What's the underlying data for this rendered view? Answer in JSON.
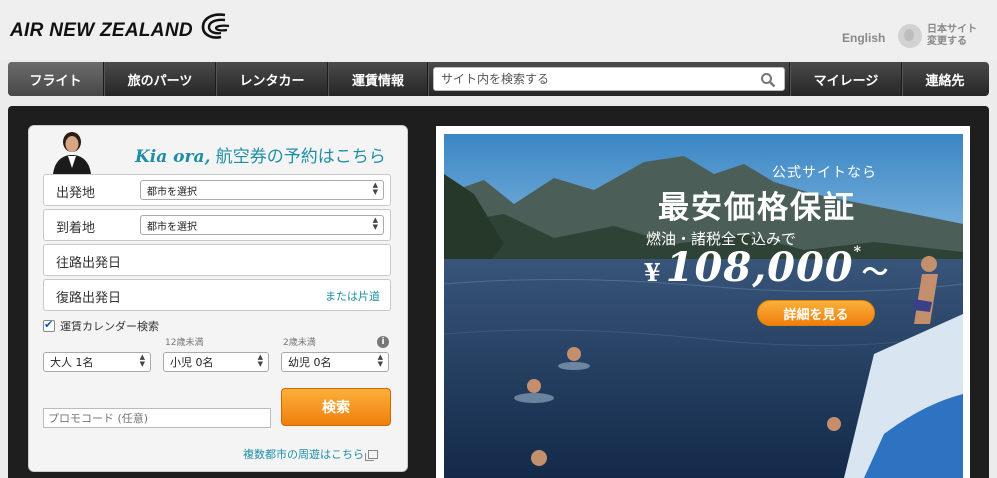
{
  "header": {
    "logo_text": "AIR NEW ZEALAND",
    "lang_english": "English",
    "lang_japan": "日本サイト\n変更する"
  },
  "nav": {
    "items_left": [
      "フライト",
      "旅のパーツ",
      "レンタカー",
      "運賃情報"
    ],
    "search_placeholder": "サイト内を検索する",
    "items_right": [
      "マイレージ",
      "連絡先"
    ]
  },
  "booking": {
    "greeting_italic": "Kia ora,",
    "greeting_rest": " 航空券の予約はこちら",
    "departure_label": "出発地",
    "departure_select": "都市を選択",
    "arrival_label": "到着地",
    "arrival_select": "都市を選択",
    "outbound_label": "往路出発日",
    "return_label": "復路出発日",
    "one_way_link": "または片道",
    "fare_calendar_label": "運賃カレンダー検索",
    "child_age_note": "12歳未満",
    "infant_age_note": "2歳未満",
    "adult_select": "大人 1名",
    "child_select": "小児 0名",
    "infant_select": "幼児 0名",
    "promo_placeholder": "プロモコード (任意)",
    "search_button": "検索",
    "multi_city_link": "複数都市の周遊はこちら"
  },
  "hero": {
    "line1": "公式サイトなら",
    "line2": "最安価格保証",
    "line3": "燃油・諸税全て込みで",
    "price_symbol": "¥",
    "price": "108,000",
    "price_mark": "*",
    "price_suffix": "〜",
    "detail_button": "詳細を見る"
  },
  "colors": {
    "accent_teal": "#1e8ea6",
    "orange": "#f39019",
    "nav_dark": "#2f2f2f"
  }
}
